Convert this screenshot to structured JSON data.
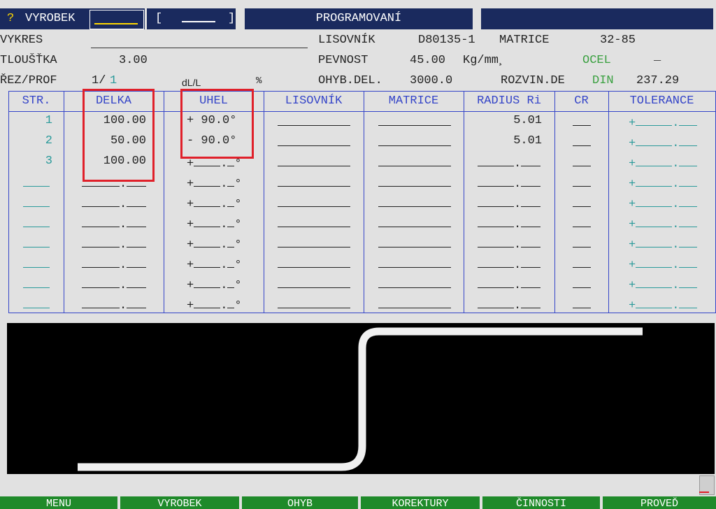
{
  "topbar": {
    "help": "?",
    "vyrobek_label": "VYROBEK",
    "bracket_open": "[",
    "bracket_close": "]",
    "mode_title": "PROGRAMOVANÍ"
  },
  "info": {
    "vykres_label": "VYKRES",
    "lisovnik_label": "LISOVNÍK",
    "lisovnik_value": "D80135-1",
    "matrice_label": "MATRICE",
    "matrice_value": "32-85",
    "tloustka_label": "TLOUŠŤKA",
    "tloustka_value": "3.00",
    "pevnost_label": "PEVNOST",
    "pevnost_value": "45.00",
    "pevnost_unit": "Kg/mm¸",
    "material": "OCEL",
    "material_extra": "_",
    "rez_label": "ŘEZ/PROF",
    "rez_value": "1/",
    "rez_value2": "1",
    "dl_label": "dL/L",
    "pct": "%",
    "ohyb_label": "OHYB.DEL.",
    "ohyb_value": "3000.0",
    "rozvin_label": "ROZVIN.DE",
    "din": "DIN",
    "rozvin_value": "237.29"
  },
  "table": {
    "headers": [
      "STR.",
      "DELKA",
      "UHEL",
      "LISOVNÍK",
      "MATRICE",
      "RADIUS Ri",
      "CR",
      "TOLERANCE"
    ],
    "rows": [
      {
        "str": "1",
        "delka": "100.00",
        "uhel": "+ 90.0°",
        "radius": "5.01"
      },
      {
        "str": "2",
        "delka": "50.00",
        "uhel": "- 90.0°",
        "radius": "5.01"
      },
      {
        "str": "3",
        "delka": "100.00",
        "uhel": "",
        "radius": ""
      }
    ],
    "empty_row_count": 7
  },
  "drawing": {
    "profile_color": "#f0f0f0"
  },
  "fkeys": [
    "MENU",
    "VYROBEK",
    "OHYB",
    "KOREKTURY",
    "ČINNOSTI",
    "PROVEĎ"
  ]
}
